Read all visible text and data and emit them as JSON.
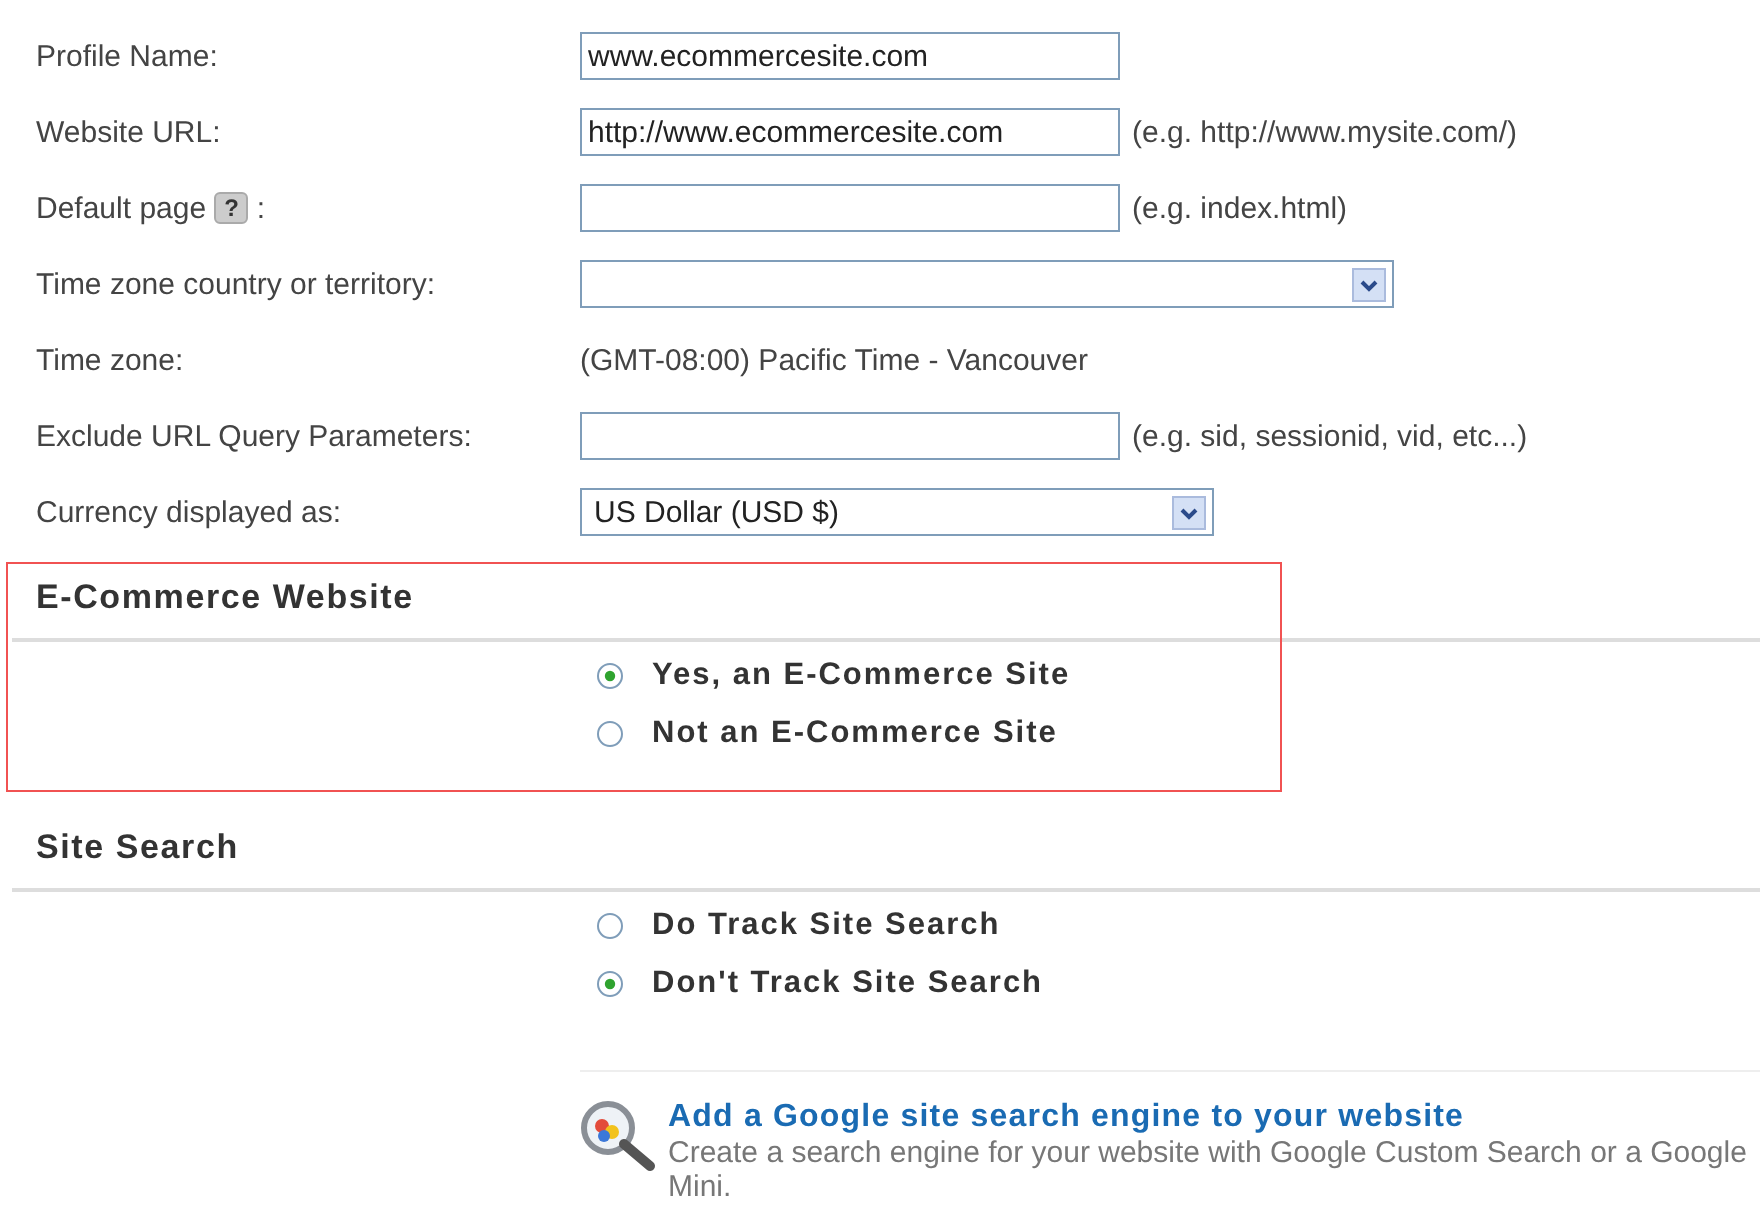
{
  "fields": [
    {
      "label": "Profile Name:",
      "kind": "input",
      "value": "www.ecommercesite.com"
    },
    {
      "label": "Website URL:",
      "kind": "input",
      "value": "http://www.ecommercesite.com",
      "hint": "(e.g. http://www.mysite.com/)"
    },
    {
      "label": "Default page",
      "help": "?",
      "label_suffix": ":",
      "kind": "input",
      "hint": "(e.g. index.html)"
    },
    {
      "label": "Time zone country or territory:",
      "kind": "wide-select"
    },
    {
      "label": "Time zone:",
      "kind": "text",
      "value": "(GMT-08:00) Pacific Time - Vancouver"
    },
    {
      "label": "Exclude URL Query Parameters:",
      "kind": "input",
      "hint": "(e.g. sid, sessionid, vid, etc...)"
    },
    {
      "label": "Currency displayed as:",
      "kind": "select",
      "value": "US Dollar (USD $)"
    }
  ],
  "sections": [
    {
      "title": "E-Commerce Website",
      "highlighted": true,
      "options": [
        {
          "label": "Yes, an E-Commerce Site",
          "selected": true
        },
        {
          "label": "Not an E-Commerce Site",
          "selected": false
        }
      ]
    },
    {
      "title": "Site Search",
      "highlighted": false,
      "options": [
        {
          "label": "Do Track Site Search",
          "selected": false
        },
        {
          "label": "Don't Track Site Search",
          "selected": true
        }
      ]
    }
  ],
  "promo": {
    "link": "Add a Google site search engine to your website",
    "description": "Create a search engine for your website with Google Custom Search or a Google Mini."
  }
}
